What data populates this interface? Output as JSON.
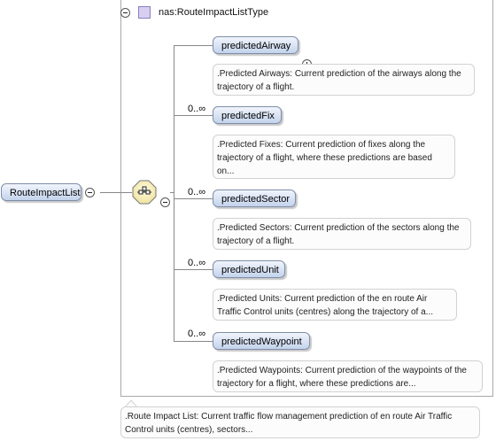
{
  "type_box": {
    "label": "nas:RouteImpactListType"
  },
  "root": {
    "label": "RouteImpactList",
    "note": ".Route Impact List: Current traffic flow management prediction of en route Air Traffic Control units (centres), sectors..."
  },
  "children": [
    {
      "label": "predictedAirway",
      "occurs": "",
      "note": ".Predicted Airways: Current prediction of the airways along the trajectory of a flight."
    },
    {
      "label": "predictedFix",
      "occurs": "0..∞",
      "note": ".Predicted Fixes: Current prediction of fixes along the trajectory of a flight, where these predictions are based on..."
    },
    {
      "label": "predictedSector",
      "occurs": "0..∞",
      "note": ".Predicted Sectors: Current prediction of the sectors along the trajectory of a flight."
    },
    {
      "label": "predictedUnit",
      "occurs": "0..∞",
      "note": ".Predicted Units: Current prediction of the en route Air Traffic Control units (centres) along the trajectory of a..."
    },
    {
      "label": "predictedWaypoint",
      "occurs": "0..∞",
      "note": ".Predicted Waypoints: Current prediction of the waypoints of the trajectory for a flight, where these predictions are..."
    }
  ]
}
